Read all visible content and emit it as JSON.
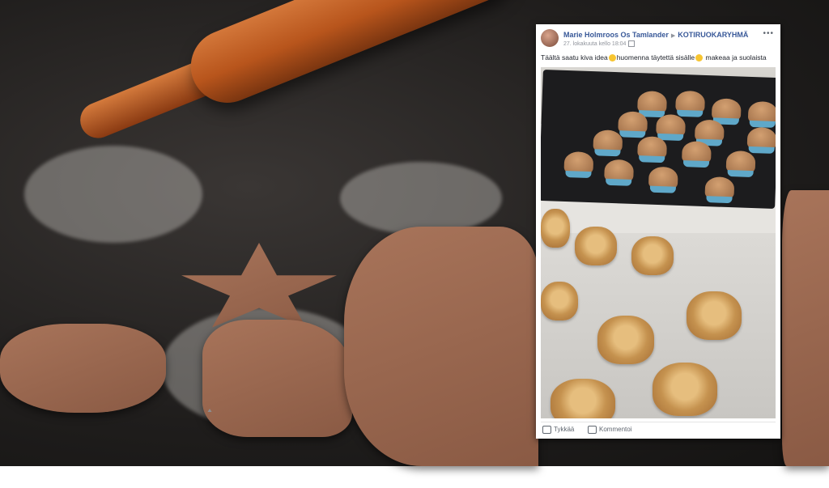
{
  "post": {
    "author": "Marie Holmroos Os Tamlander",
    "group": "KOTIRUOKARYHMÄ",
    "timestamp": "27. lokakuuta kello 18:04",
    "text": "Täältä saatu kiva idea",
    "text2": "huomenna täytettä sisälle",
    "text3": "makeaa ja suolaista",
    "more": "•••",
    "like_label": "Tykkää",
    "comment_label": "Kommentoi"
  },
  "colors": {
    "link": "#385898",
    "muted": "#90949c"
  },
  "icons": [
    "avatar",
    "more-icon",
    "globe-icon",
    "like-icon",
    "comment-icon",
    "smiley-emoji"
  ]
}
